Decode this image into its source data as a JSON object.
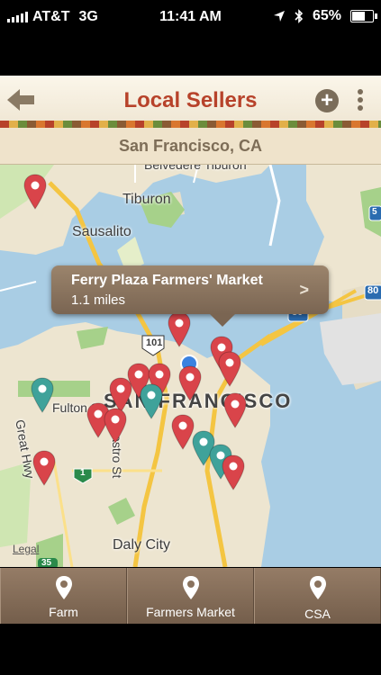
{
  "status_bar": {
    "carrier": "AT&T",
    "network": "3G",
    "time": "11:41 AM",
    "battery": "65%",
    "battery_level": 0.65
  },
  "header": {
    "title": "Local Sellers",
    "location": "San Francisco, CA",
    "title_color": "#b7422a"
  },
  "map": {
    "labels": {
      "tiburon": "Tiburon",
      "sausalito": "Sausalito",
      "belvedere": "Belvedere Tiburon",
      "san_francisco": "SAN FRANCISCO",
      "daly_city": "Daly City",
      "fulton": "Fulton St",
      "castro": "Castro St",
      "great_hwy": "Great Hwy",
      "hwy_101": "101",
      "hwy_80": "80",
      "hwy_1": "1",
      "hwy_35": "35",
      "hwy_5": "5"
    },
    "legal": "Legal",
    "callout": {
      "title": "Ferry Plaza Farmers' Market",
      "subtitle": "1.1 miles"
    },
    "pin_colors": {
      "farmers_market": "#d9444a",
      "csa": "#3fa29a"
    }
  },
  "tabs": [
    {
      "label": "Farm"
    },
    {
      "label": "Farmers Market"
    },
    {
      "label": "CSA"
    }
  ]
}
